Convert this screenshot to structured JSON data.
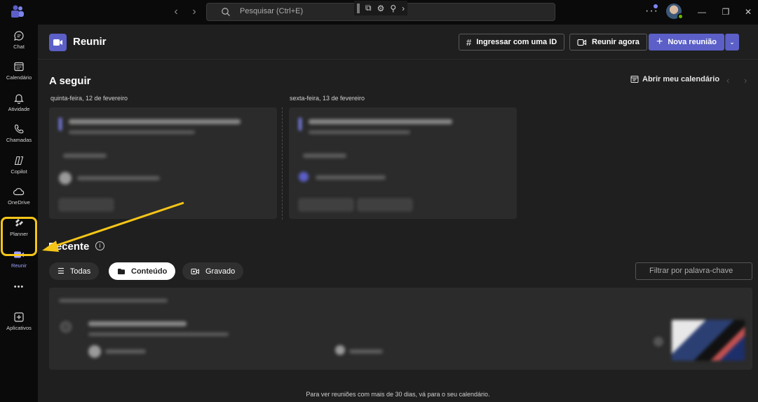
{
  "search": {
    "placeholder": "Pesquisar (Ctrl+E)"
  },
  "rail": {
    "items": [
      {
        "label": "Chat",
        "icon": "chat-icon"
      },
      {
        "label": "Calendário",
        "icon": "calendar-icon"
      },
      {
        "label": "Atividade",
        "icon": "bell-icon"
      },
      {
        "label": "Chamadas",
        "icon": "phone-icon"
      },
      {
        "label": "Copilot",
        "icon": "copilot-icon"
      },
      {
        "label": "OneDrive",
        "icon": "cloud-icon"
      },
      {
        "label": "Planner",
        "icon": "planner-icon"
      },
      {
        "label": "Reunir",
        "icon": "video-icon"
      },
      {
        "label": "Aplicativos",
        "icon": "plus-square-icon"
      }
    ],
    "more": "•••"
  },
  "header": {
    "title": "Reunir",
    "join_id": "Ingressar com uma ID",
    "meet_now": "Reunir agora",
    "new_meeting": "Nova reunião"
  },
  "upcoming": {
    "title": "A seguir",
    "calendar_link": "Abrir meu calendário",
    "days": [
      {
        "label": "quinta-feira, 12 de fevereiro"
      },
      {
        "label": "sexta-feira, 13 de fevereiro"
      }
    ]
  },
  "recent": {
    "title": "Recente",
    "filters": [
      {
        "label": "Todas"
      },
      {
        "label": "Conteúdo"
      },
      {
        "label": "Gravado"
      }
    ],
    "keyword_placeholder": "Filtrar por palavra-chave"
  },
  "footer": "Para ver reuniões com mais de 30 dias, vá para o seu calendário.",
  "colors": {
    "accent": "#5b5fc7",
    "highlight": "#f5c518"
  }
}
